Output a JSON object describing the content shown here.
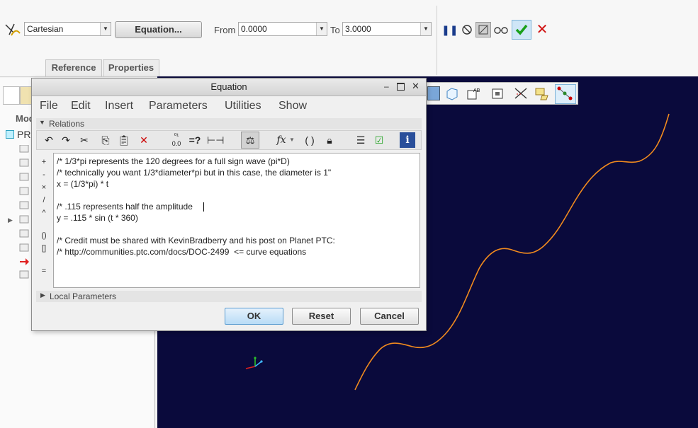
{
  "dashboard": {
    "coord_system": "Cartesian",
    "equation_button": "Equation...",
    "from_label": "From",
    "from_value": "0.0000",
    "to_label": "To",
    "to_value": "3.0000",
    "tabs": [
      "Reference",
      "Properties"
    ],
    "icons": [
      "pause-icon",
      "no-preview-icon",
      "verify-icon",
      "glasses-icon",
      "check-icon",
      "close-icon"
    ],
    "colors": {
      "accept": "#1aa01a",
      "cancel": "#d01010"
    }
  },
  "tree": {
    "header_fragment": "Mod",
    "root_fragment": "PR"
  },
  "dialog": {
    "title": "Equation",
    "menu": [
      "File",
      "Edit",
      "Insert",
      "Parameters",
      "Utilities",
      "Show"
    ],
    "relations_label": "Relations",
    "operators": [
      "+",
      "-",
      "×",
      "/",
      "^",
      "()",
      "[]",
      "="
    ],
    "code_lines": [
      "/* 1/3*pi represents the 120 degrees for a full sign wave (pi*D)",
      "/* technically you want 1/3*diameter*pi but in this case, the diameter is 1\"",
      "x = (1/3*pi) * t",
      "",
      "/* .115 represents half the amplitude",
      "y = .115 * sin (t * 360)",
      "",
      "/* Credit must be shared with KevinBradberry and his post on Planet PTC:",
      "/* http://communities.ptc.com/docs/DOC-2499  <= curve equations"
    ],
    "local_params_label": "Local Parameters",
    "buttons": {
      "ok": "OK",
      "reset": "Reset",
      "cancel": "Cancel"
    }
  },
  "viewport": {
    "background": "#0a0a3c",
    "curve_color": "#f08a1e"
  }
}
